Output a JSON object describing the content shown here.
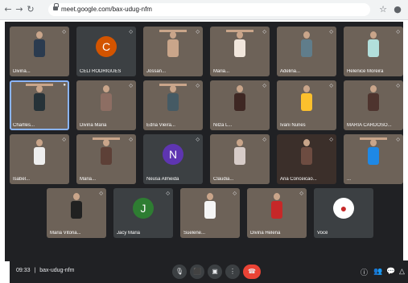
{
  "browser": {
    "url": "meet.google.com/bax-udug-nfm"
  },
  "meeting": {
    "time": "09:33",
    "meeting_code": "bax-udug-nfm"
  },
  "tiles": [
    {
      "name": "Divina...",
      "type": "video"
    },
    {
      "name": "CELI RODRIGUES",
      "type": "avatar",
      "initial": "C",
      "color": "#d35400"
    },
    {
      "name": "Jossan...",
      "type": "video"
    },
    {
      "name": "Maria...",
      "type": "video"
    },
    {
      "name": "Adelina...",
      "type": "video"
    },
    {
      "name": "Helenice Moreira",
      "type": "video"
    },
    {
      "name": "Charlles...",
      "type": "video",
      "selected": true
    },
    {
      "name": "Divina Maria",
      "type": "video"
    },
    {
      "name": "Edna Vieira...",
      "type": "video"
    },
    {
      "name": "Nilza L...",
      "type": "video"
    },
    {
      "name": "Ivani Nunes",
      "type": "video"
    },
    {
      "name": "MARIA CARDOSO...",
      "type": "video"
    },
    {
      "name": "Isabel...",
      "type": "video"
    },
    {
      "name": "Maria...",
      "type": "video"
    },
    {
      "name": "Neusa Almeida",
      "type": "avatar",
      "initial": "N",
      "color": "#5e35b1"
    },
    {
      "name": "Claudia...",
      "type": "video"
    },
    {
      "name": "Ana Conceicao...",
      "type": "video"
    },
    {
      "name": "...",
      "type": "video"
    },
    {
      "name": "Maria Vitoria...",
      "type": "video"
    },
    {
      "name": "Jacy Maria",
      "type": "avatar",
      "initial": "J",
      "color": "#2e7d32"
    },
    {
      "name": "Suelene...",
      "type": "video"
    },
    {
      "name": "Divina Helena",
      "type": "video"
    },
    {
      "name": "Você",
      "type": "avatar_photo"
    }
  ],
  "controls": {
    "buttons": [
      "mic",
      "camera",
      "present",
      "more",
      "end-call"
    ],
    "right": [
      "info",
      "people",
      "chat",
      "activities"
    ]
  }
}
